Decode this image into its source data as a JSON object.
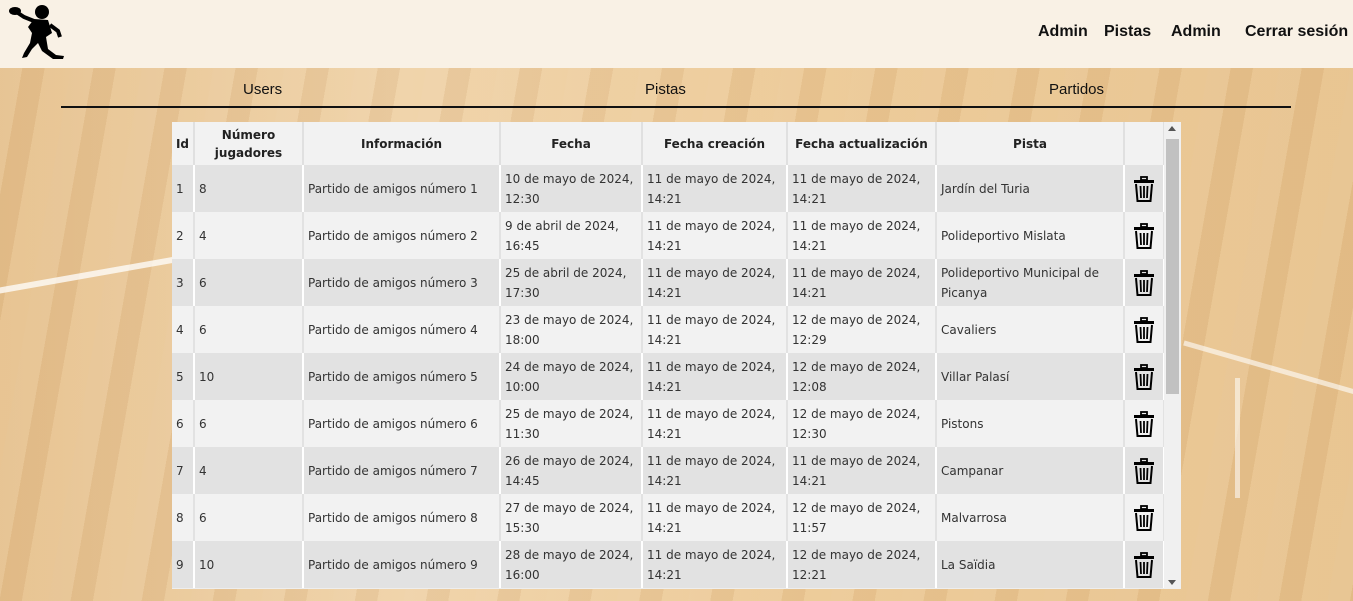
{
  "navbar": {
    "logo_icon": "padel-player-silhouette-icon",
    "items": [
      "Admin",
      "Pistas",
      "Admin",
      "Cerrar sesión"
    ]
  },
  "tabs": [
    "Users",
    "Pistas",
    "Partidos"
  ],
  "table": {
    "headers": [
      "Id",
      "Número jugadores",
      "Información",
      "Fecha",
      "Fecha creación",
      "Fecha actualización",
      "Pista",
      ""
    ],
    "rows": [
      {
        "id": "1",
        "players": "8",
        "info": "Partido de amigos número 1",
        "fecha": "10 de mayo de 2024, 12:30",
        "creacion": "11 de mayo de 2024, 14:21",
        "actualizacion": "11 de mayo de 2024, 14:21",
        "pista": "Jardín del Turia"
      },
      {
        "id": "2",
        "players": "4",
        "info": "Partido de amigos número 2",
        "fecha": "9 de abril de 2024, 16:45",
        "creacion": "11 de mayo de 2024, 14:21",
        "actualizacion": "11 de mayo de 2024, 14:21",
        "pista": "Polideportivo Mislata"
      },
      {
        "id": "3",
        "players": "6",
        "info": "Partido de amigos número 3",
        "fecha": "25 de abril de 2024, 17:30",
        "creacion": "11 de mayo de 2024, 14:21",
        "actualizacion": "11 de mayo de 2024, 14:21",
        "pista": "Polideportivo Municipal de Picanya"
      },
      {
        "id": "4",
        "players": "6",
        "info": "Partido de amigos número 4",
        "fecha": "23 de mayo de 2024, 18:00",
        "creacion": "11 de mayo de 2024, 14:21",
        "actualizacion": "12 de mayo de 2024, 12:29",
        "pista": "Cavaliers"
      },
      {
        "id": "5",
        "players": "10",
        "info": "Partido de amigos número 5",
        "fecha": "24 de mayo de 2024, 10:00",
        "creacion": "11 de mayo de 2024, 14:21",
        "actualizacion": "12 de mayo de 2024, 12:08",
        "pista": "Villar Palasí"
      },
      {
        "id": "6",
        "players": "6",
        "info": "Partido de amigos número 6",
        "fecha": "25 de mayo de 2024, 11:30",
        "creacion": "11 de mayo de 2024, 14:21",
        "actualizacion": "12 de mayo de 2024, 12:30",
        "pista": "Pistons"
      },
      {
        "id": "7",
        "players": "4",
        "info": "Partido de amigos número 7",
        "fecha": "26 de mayo de 2024, 14:45",
        "creacion": "11 de mayo de 2024, 14:21",
        "actualizacion": "11 de mayo de 2024, 14:21",
        "pista": "Campanar"
      },
      {
        "id": "8",
        "players": "6",
        "info": "Partido de amigos número 8",
        "fecha": "27 de mayo de 2024, 15:30",
        "creacion": "11 de mayo de 2024, 14:21",
        "actualizacion": "12 de mayo de 2024, 11:57",
        "pista": "Malvarrosa"
      },
      {
        "id": "9",
        "players": "10",
        "info": "Partido de amigos número 9",
        "fecha": "28 de mayo de 2024, 16:00",
        "creacion": "11 de mayo de 2024, 14:21",
        "actualizacion": "12 de mayo de 2024, 12:21",
        "pista": "La Saïdia"
      }
    ],
    "delete_icon": "trash-icon"
  }
}
